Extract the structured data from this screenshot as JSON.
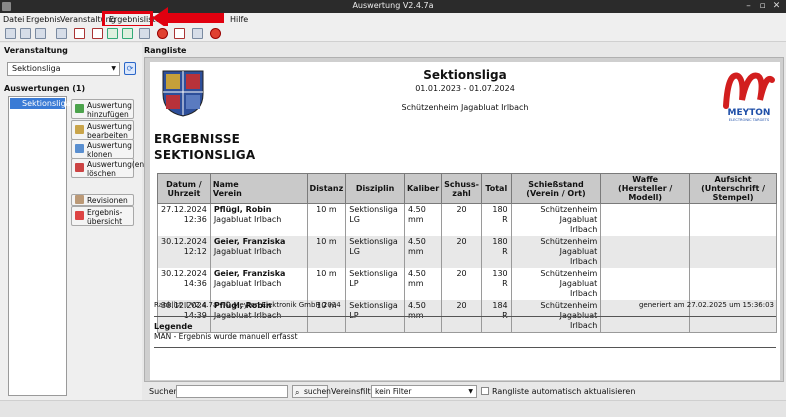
{
  "window": {
    "title": "Auswertung V2.4.7a"
  },
  "menu": {
    "items": [
      "Datei",
      "Ergebnis",
      "Veranstaltung",
      "Ergebnisliste",
      "Hilfe"
    ]
  },
  "left": {
    "event_label": "Veranstaltung",
    "event_selected": "Sektionsliga",
    "evals_label": "Auswertungen (1)",
    "eval_items": [
      "Sektionsliga"
    ],
    "buttons": {
      "add": "Auswertung hinzufügen",
      "edit": "Auswertung bearbeiten",
      "clone": "Auswertung klonen",
      "delete": "Auswertung(en) löschen",
      "revisions": "Revisionen",
      "overview": "Ergebnis-übersicht"
    }
  },
  "right": {
    "label": "Rangliste"
  },
  "report": {
    "title": "Sektionsliga",
    "dates": "01.01.2023 - 01.07.2024",
    "venue": "Schützenheim Jagabluat Irlbach",
    "heading_line1": "ERGEBNISSE",
    "heading_line2": "SEKTIONSLIGA",
    "logo_text": "MEYTON",
    "logo_sub": "ELECTRONIC TARGETS",
    "columns": {
      "date1": "Datum /",
      "date2": "Uhrzeit",
      "name1": "Name",
      "name2": "Verein",
      "dist": "Distanz",
      "disz": "Disziplin",
      "kal": "Kaliber",
      "shot1": "Schuss-",
      "shot2": "zahl",
      "tot": "Total",
      "stand1": "Schießstand",
      "stand2": "(Verein / Ort)",
      "waffe1": "Waffe",
      "waffe2": "(Hersteller / Modell)",
      "aufs1": "Aufsicht",
      "aufs2": "(Unterschrift / Stempel)"
    },
    "rows": [
      {
        "date": "27.12.2024",
        "time": "12:36",
        "name": "Pflügl, Robin",
        "club": "Jagabluat Irlbach",
        "dist": "10 m",
        "disz": "Sektionsliga LG",
        "kal": "4.50 mm",
        "shots": "20",
        "total": "180 R",
        "stand1": "Schützenheim Jagabluat",
        "stand2": "Irlbach"
      },
      {
        "date": "30.12.2024",
        "time": "12:12",
        "name": "Geier, Franziska",
        "club": "Jagabluat Irlbach",
        "dist": "10 m",
        "disz": "Sektionsliga LG",
        "kal": "4.50 mm",
        "shots": "20",
        "total": "180 R",
        "stand1": "Schützenheim Jagabluat",
        "stand2": "Irlbach"
      },
      {
        "date": "30.12.2024",
        "time": "14:36",
        "name": "Geier, Franziska",
        "club": "Jagabluat Irlbach",
        "dist": "10 m",
        "disz": "Sektionsliga LP",
        "kal": "4.50 mm",
        "shots": "20",
        "total": "130 R",
        "stand1": "Schützenheim Jagabluat",
        "stand2": "Irlbach"
      },
      {
        "date": "30.12.2024",
        "time": "14:39",
        "name": "Pflügl, Robin",
        "club": "Jagabluat Irlbach",
        "dist": "10 m",
        "disz": "Sektionsliga LP",
        "kal": "4.50 mm",
        "shots": "20",
        "total": "184 R",
        "stand1": "Schützenheim Jagabluat",
        "stand2": "Irlbach"
      }
    ],
    "footer_left": "Ranklist II V2.4.7a - © Meyton Elektronik GmbH 2024",
    "footer_right": "generiert am 27.02.2025 um 15:36:03",
    "legend_title": "Legende",
    "legend_text": "MAN - Ergebnis wurde manuell erfasst"
  },
  "bottom": {
    "search_label": "Suchen:",
    "search_value": "",
    "search_button": "suchen",
    "filter_label": "Vereinsfilter:",
    "filter_selected": "kein Filter",
    "auto_refresh_label": "Rangliste automatisch aktualisieren",
    "auto_refresh_checked": false
  },
  "colors": {
    "annotation_red": "#e1000f",
    "selection_blue": "#3a7bd5",
    "meyton_red": "#d21e1e",
    "meyton_blue": "#1f4fa8"
  }
}
